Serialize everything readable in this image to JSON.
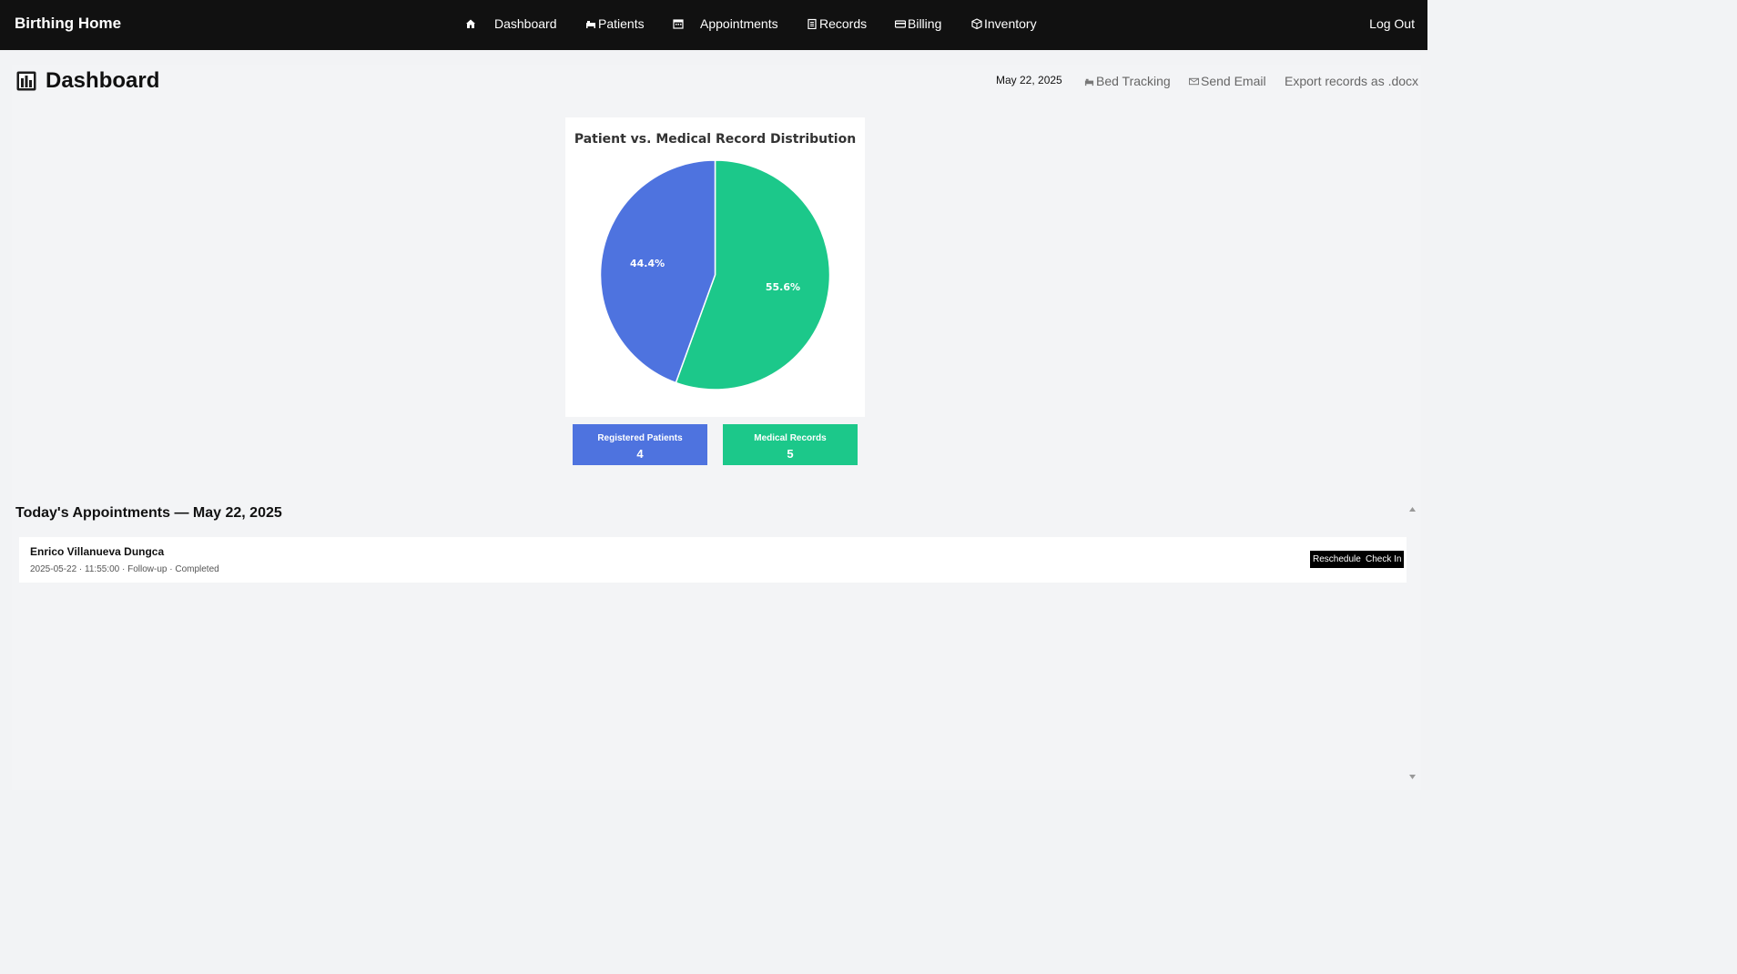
{
  "nav": {
    "brand": "Birthing Home",
    "items": [
      {
        "label": "Dashboard",
        "icon": "house-icon"
      },
      {
        "label": "Patients",
        "icon": "bed-icon"
      },
      {
        "label": "Appointments",
        "icon": "calendar-icon"
      },
      {
        "label": "Records",
        "icon": "clipboard-icon"
      },
      {
        "label": "Billing",
        "icon": "credit-card-icon"
      },
      {
        "label": "Inventory",
        "icon": "package-icon"
      }
    ],
    "logout": "Log Out"
  },
  "header": {
    "title": "Dashboard",
    "title_icon": "bar-chart-icon",
    "date": "May 22, 2025",
    "links": {
      "bed_tracking": "Bed Tracking",
      "send_email": "Send Email",
      "export": "Export records as .docx"
    }
  },
  "chart_data": {
    "type": "pie",
    "title": "Patient vs. Medical Record Distribution",
    "categories": [
      "Registered Patients",
      "Medical Records"
    ],
    "values": [
      4,
      5
    ],
    "percent_labels": [
      "44.4%",
      "55.6%"
    ],
    "colors": [
      "#4e73df",
      "#1cc88a"
    ]
  },
  "stats": {
    "patients": {
      "label": "Registered Patients",
      "value": "4",
      "color": "#4e73df"
    },
    "records": {
      "label": "Medical Records",
      "value": "5",
      "color": "#1cc88a"
    }
  },
  "appointments": {
    "title": "Today's Appointments — May 22, 2025",
    "items": [
      {
        "name": "Enrico Villanueva Dungca",
        "meta": "2025-05-22 · 11:55:00 · Follow-up · Completed",
        "reschedule_label": "Reschedule",
        "checkin_label": "Check In"
      }
    ]
  }
}
